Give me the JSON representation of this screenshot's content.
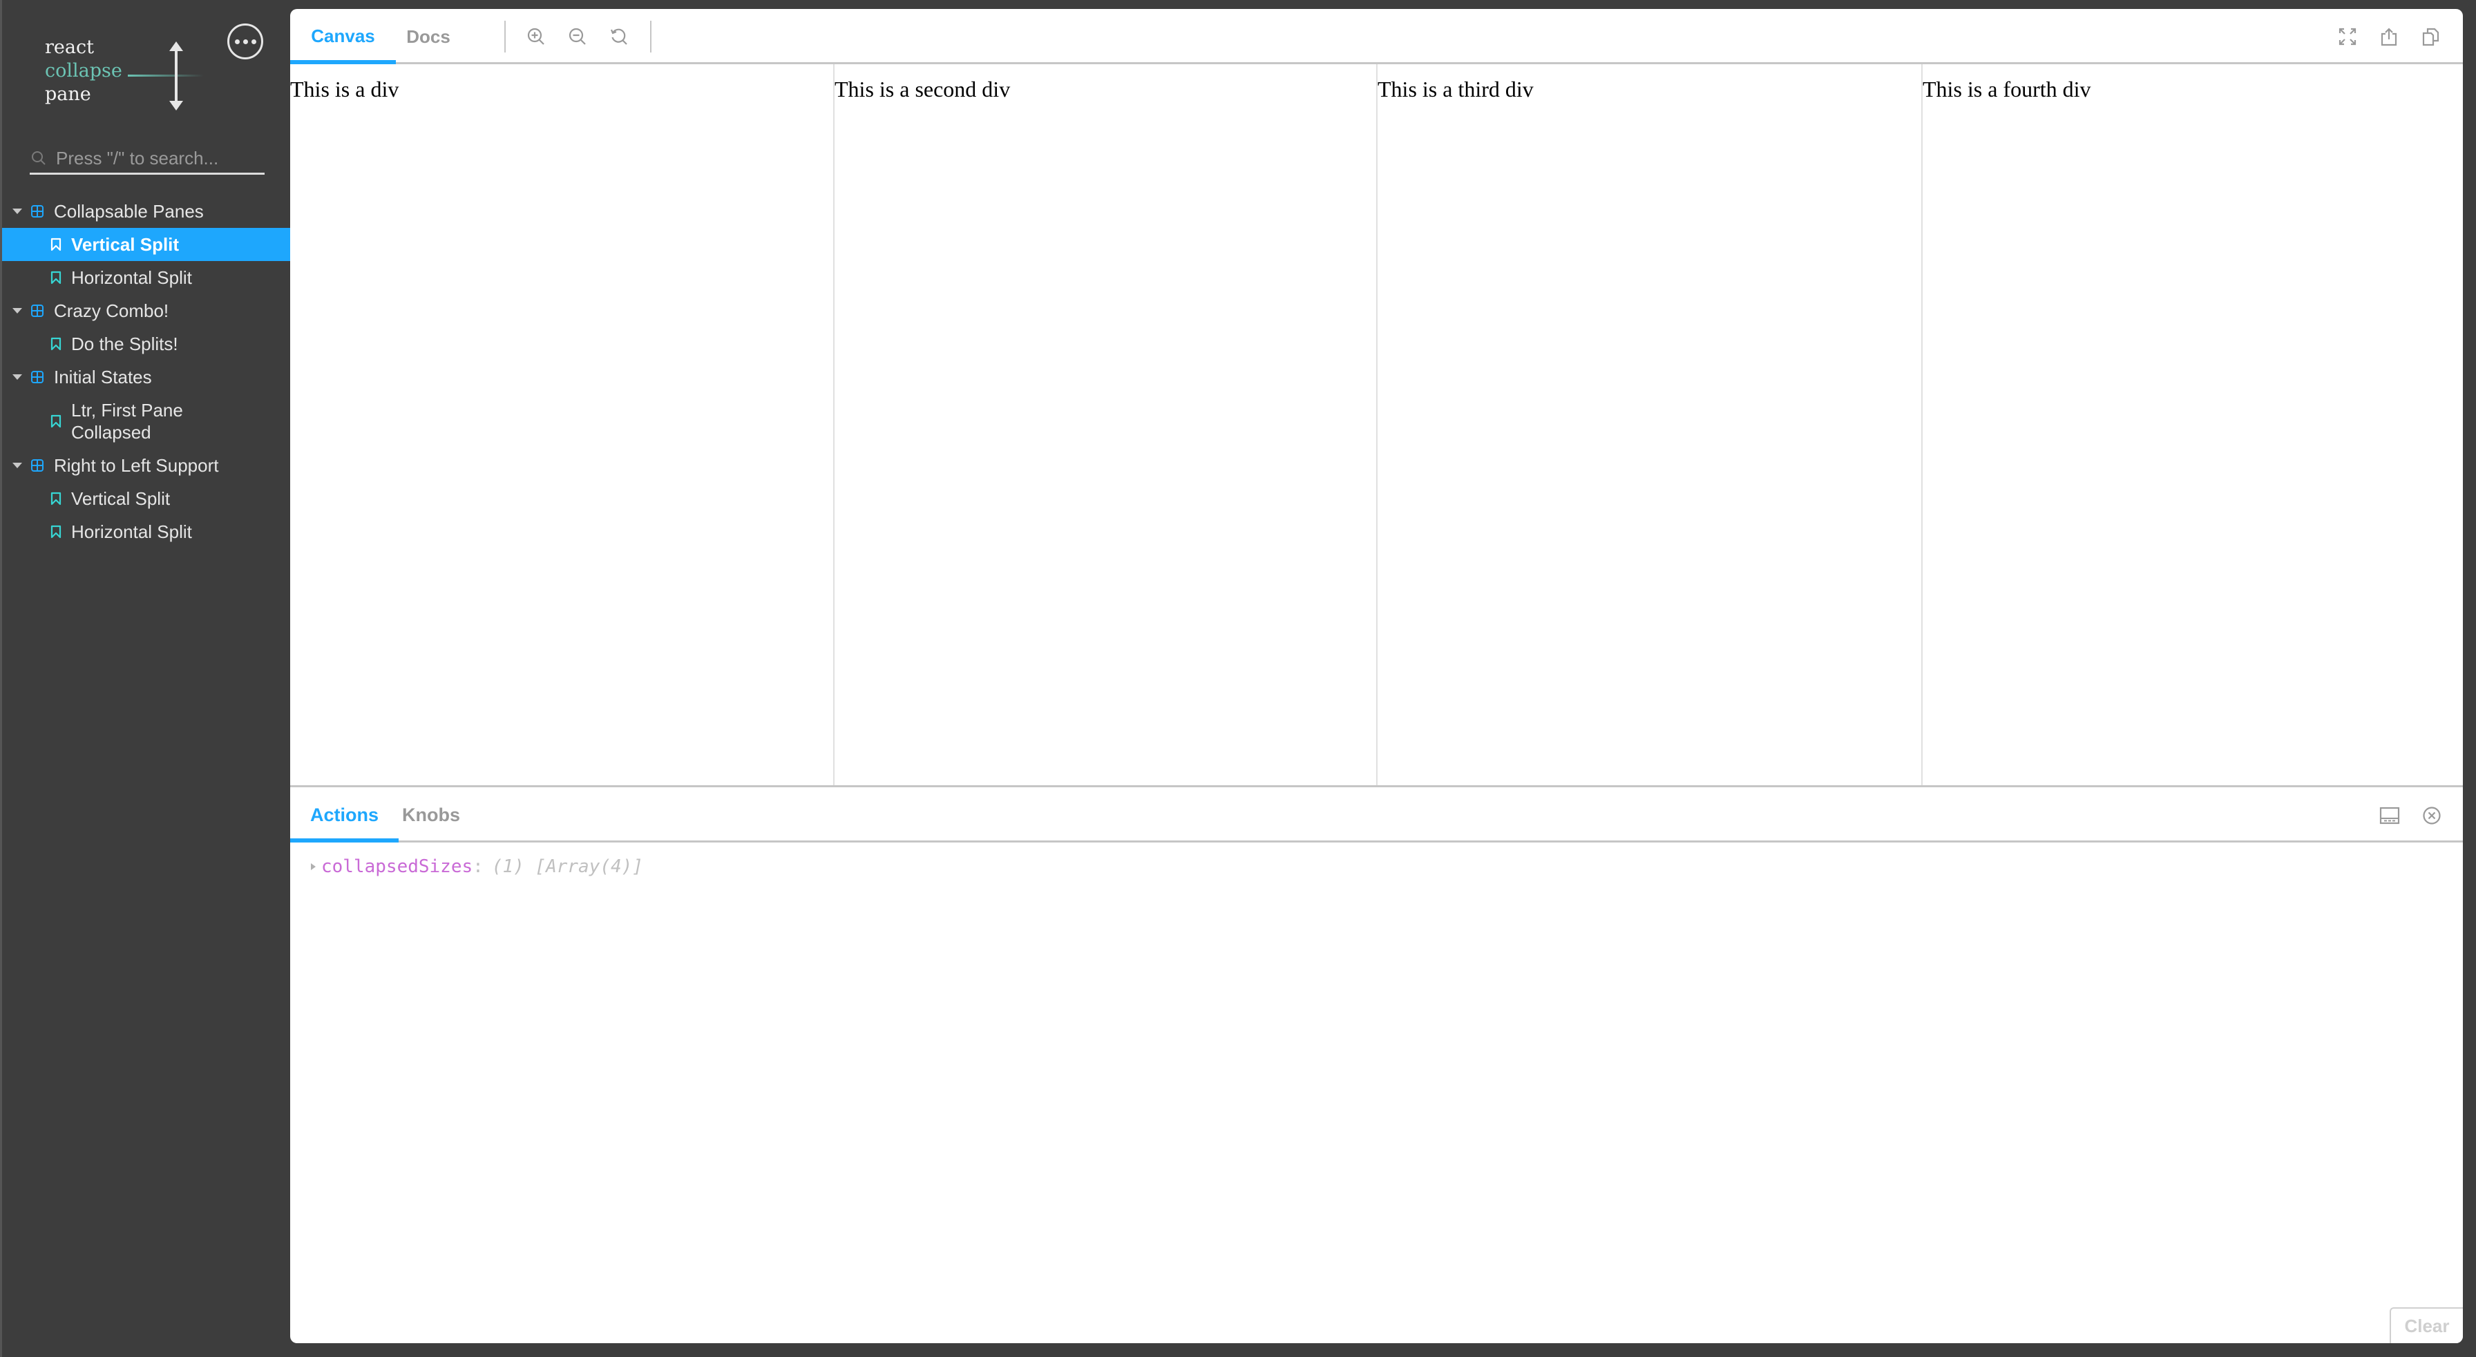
{
  "sidebar": {
    "logo": {
      "line1": "react",
      "line2": "collapse",
      "line3": "pane"
    },
    "more_button_label": "more-options",
    "search": {
      "placeholder": "Press \"/\" to search...",
      "value": ""
    },
    "tree": [
      {
        "type": "group",
        "label": "Collapsable Panes",
        "expanded": true
      },
      {
        "type": "story",
        "label": "Vertical Split",
        "selected": true
      },
      {
        "type": "story",
        "label": "Horizontal Split",
        "selected": false
      },
      {
        "type": "group",
        "label": "Crazy Combo!",
        "expanded": true
      },
      {
        "type": "story",
        "label": "Do the Splits!",
        "selected": false
      },
      {
        "type": "group",
        "label": "Initial States",
        "expanded": true
      },
      {
        "type": "story",
        "label_line1": "Ltr, First Pane",
        "label_line2": "Collapsed",
        "selected": false
      },
      {
        "type": "group",
        "label": "Right to Left Support",
        "expanded": true
      },
      {
        "type": "story",
        "label": "Vertical Split",
        "selected": false
      },
      {
        "type": "story",
        "label": "Horizontal Split",
        "selected": false
      }
    ]
  },
  "toolbar": {
    "tabs": [
      {
        "label": "Canvas",
        "active": true
      },
      {
        "label": "Docs",
        "active": false
      }
    ],
    "icons": [
      "zoom-in-icon",
      "zoom-out-icon",
      "reset-zoom-icon",
      "fullscreen-icon",
      "share-icon",
      "copy-icon"
    ]
  },
  "canvas": {
    "panes": [
      {
        "text": "This is a div"
      },
      {
        "text": "This is a second div"
      },
      {
        "text": "This is a third div"
      },
      {
        "text": "This is a fourth div"
      }
    ]
  },
  "addons": {
    "tabs": [
      {
        "label": "Actions",
        "active": true
      },
      {
        "label": "Knobs",
        "active": false
      }
    ],
    "actions": [
      {
        "name": "collapsedSizes",
        "colon": ":",
        "value": "(1) [Array(4)]"
      }
    ],
    "clear_label": "Clear"
  },
  "colors": {
    "accent": "#1ea7fd",
    "logo_accent": "#6cc4b4",
    "sidebar_bg": "#3d3d3d",
    "action_key": "#c96ad6"
  }
}
